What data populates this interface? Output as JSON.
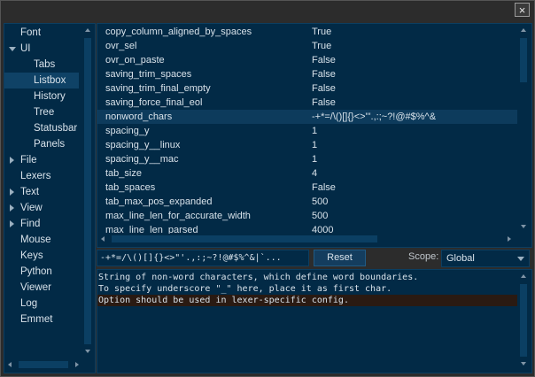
{
  "window": {
    "close_label": "×"
  },
  "tree": {
    "items": [
      {
        "label": "Font",
        "expander": "none",
        "indent": 0
      },
      {
        "label": "UI",
        "expander": "expanded",
        "indent": 0
      },
      {
        "label": "Tabs",
        "expander": "none",
        "indent": 1
      },
      {
        "label": "Listbox",
        "expander": "none",
        "indent": 1,
        "selected": true
      },
      {
        "label": "History",
        "expander": "none",
        "indent": 1
      },
      {
        "label": "Tree",
        "expander": "none",
        "indent": 1
      },
      {
        "label": "Statusbar",
        "expander": "none",
        "indent": 1
      },
      {
        "label": "Panels",
        "expander": "none",
        "indent": 1
      },
      {
        "label": "File",
        "expander": "collapsed",
        "indent": 0
      },
      {
        "label": "Lexers",
        "expander": "none",
        "indent": 0
      },
      {
        "label": "Text",
        "expander": "collapsed",
        "indent": 0
      },
      {
        "label": "View",
        "expander": "collapsed",
        "indent": 0
      },
      {
        "label": "Find",
        "expander": "collapsed",
        "indent": 0
      },
      {
        "label": "Mouse",
        "expander": "none",
        "indent": 0
      },
      {
        "label": "Keys",
        "expander": "none",
        "indent": 0
      },
      {
        "label": "Python",
        "expander": "none",
        "indent": 0
      },
      {
        "label": "Viewer",
        "expander": "none",
        "indent": 0
      },
      {
        "label": "Log",
        "expander": "none",
        "indent": 0
      },
      {
        "label": "Emmet",
        "expander": "none",
        "indent": 0
      }
    ]
  },
  "options": {
    "rows": [
      {
        "key": "copy_column_aligned_by_spaces",
        "value": "True"
      },
      {
        "key": "ovr_sel",
        "value": "True"
      },
      {
        "key": "ovr_on_paste",
        "value": "False"
      },
      {
        "key": "saving_trim_spaces",
        "value": "False"
      },
      {
        "key": "saving_trim_final_empty",
        "value": "False"
      },
      {
        "key": "saving_force_final_eol",
        "value": "False"
      },
      {
        "key": "nonword_chars",
        "value": "-+*=/\\()[]{}<>\"'.,:;~?!@#$%^&",
        "selected": true
      },
      {
        "key": "spacing_y",
        "value": "1"
      },
      {
        "key": "spacing_y__linux",
        "value": "1"
      },
      {
        "key": "spacing_y__mac",
        "value": "1"
      },
      {
        "key": "tab_size",
        "value": "4"
      },
      {
        "key": "tab_spaces",
        "value": "False"
      },
      {
        "key": "tab_max_pos_expanded",
        "value": "500"
      },
      {
        "key": "max_line_len_for_accurate_width",
        "value": "500"
      },
      {
        "key": "max_line_len_parsed",
        "value": "4000"
      }
    ]
  },
  "editor": {
    "value": "-+*=/\\()[]{}<>\"'.,:;~?!@#$%^&|`...",
    "reset_label": "Reset",
    "scope_label": "Scope:",
    "scope_value": "Global"
  },
  "info": {
    "lines": [
      "String of non-word characters, which define word boundaries.",
      "To specify underscore \"_\" here, place it as first char.",
      "Option should be used in lexer-specific config."
    ]
  }
}
